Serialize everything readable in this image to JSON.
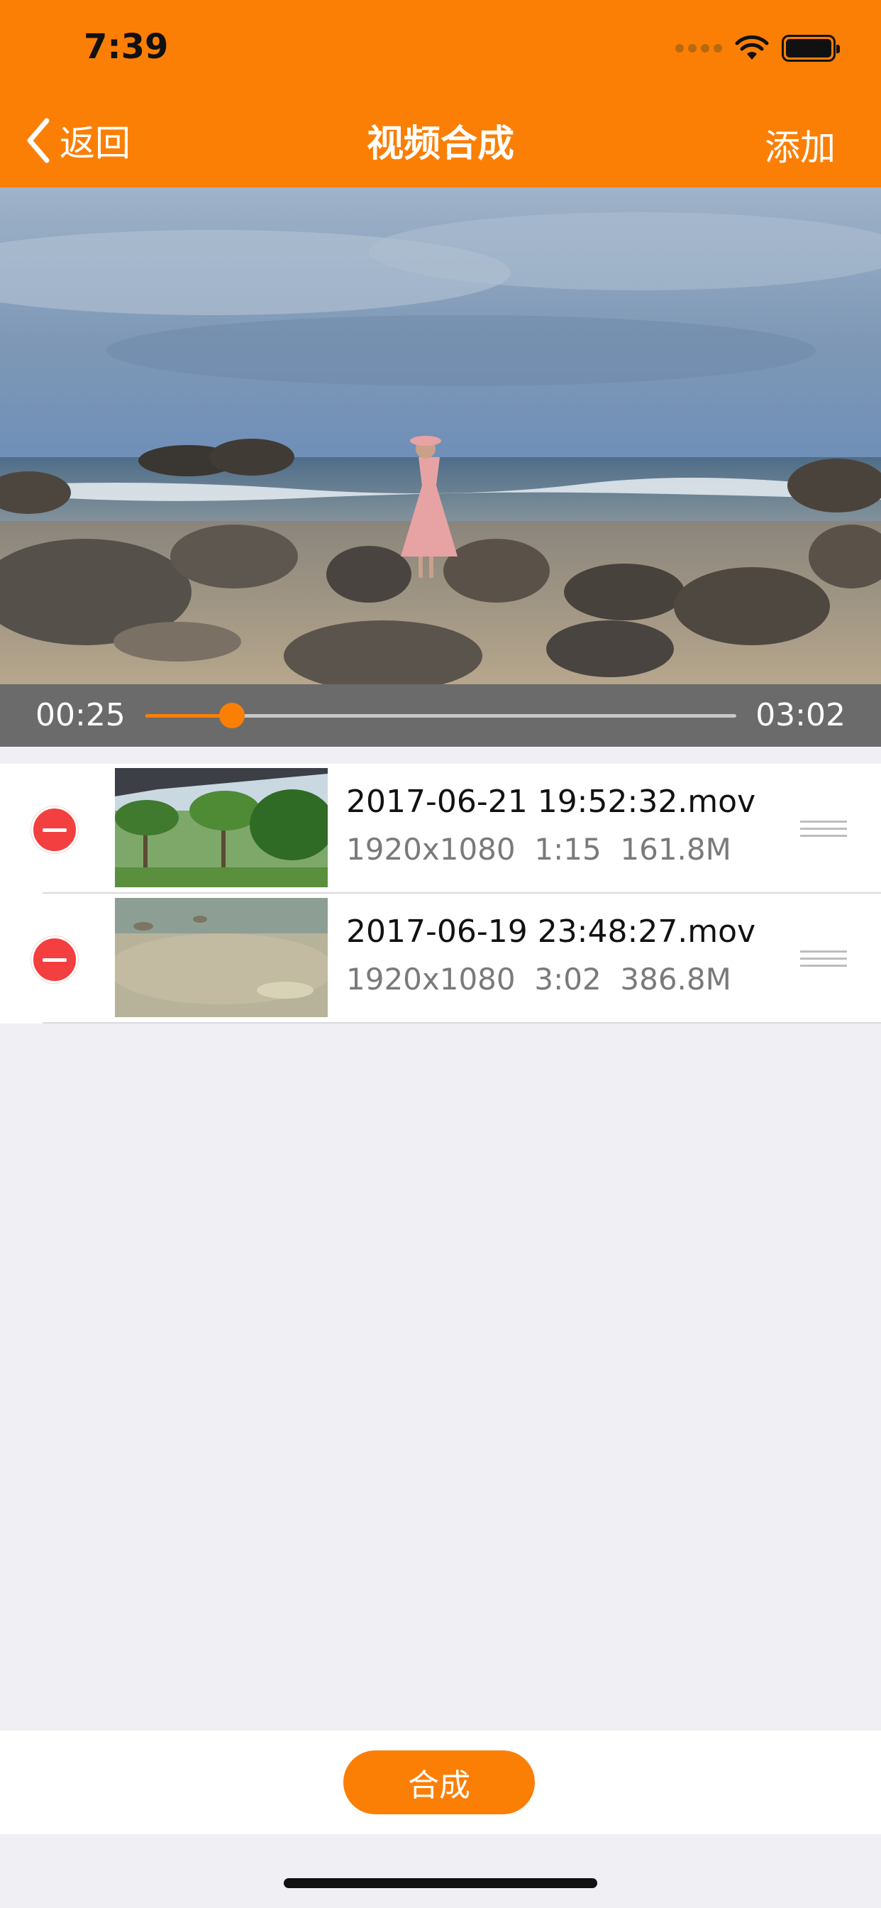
{
  "status_bar": {
    "time": "7:39"
  },
  "nav": {
    "back_label": "返回",
    "title": "视频合成",
    "add_label": "添加"
  },
  "player": {
    "current_time": "00:25",
    "total_time": "03:02",
    "progress": 0.146
  },
  "videos": [
    {
      "file_name": "2017-06-21 19:52:32.mov",
      "resolution": "1920x1080",
      "duration": "1:15",
      "size": "161.8M"
    },
    {
      "file_name": "2017-06-19 23:48:27.mov",
      "resolution": "1920x1080",
      "duration": "3:02",
      "size": "386.8M"
    }
  ],
  "actions": {
    "compose_label": "合成"
  },
  "colors": {
    "accent": "#fb7f05",
    "delete": "#f33f3f"
  }
}
